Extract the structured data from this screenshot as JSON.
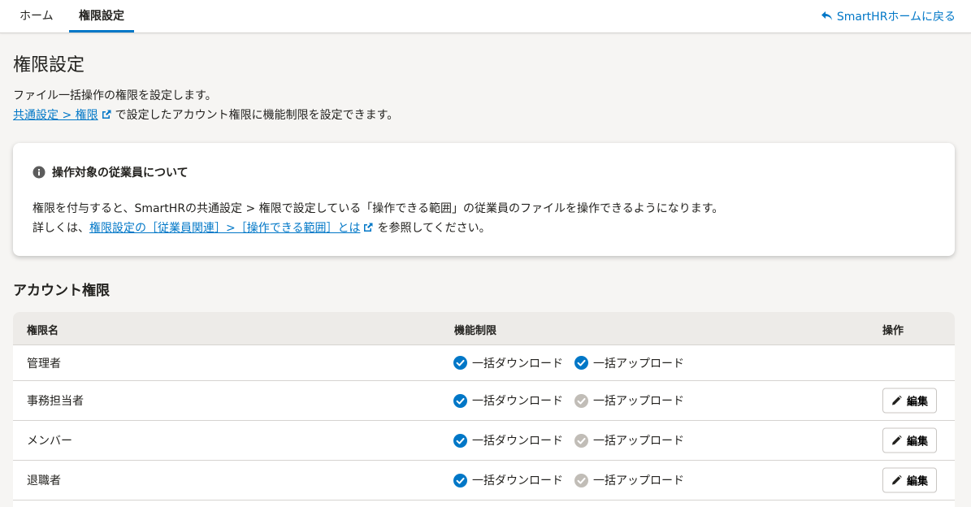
{
  "nav": {
    "tabs": [
      {
        "label": "ホーム",
        "active": false
      },
      {
        "label": "権限設定",
        "active": true
      }
    ],
    "back_link": "SmartHRホームに戻る"
  },
  "page": {
    "title": "権限設定",
    "description": "ファイル一括操作の権限を設定します。",
    "settings_link": "共通設定 > 権限",
    "settings_suffix": "で設定したアカウント権限に機能制限を設定できます。"
  },
  "info": {
    "title": "操作対象の従業員について",
    "line1": "権限を付与すると、SmartHRの共通設定 > 権限で設定している「操作できる範囲」の従業員のファイルを操作できるようになります。",
    "line2_prefix": "詳しくは、",
    "line2_link": "権限設定の［従業員関連］>［操作できる範囲］とは",
    "line2_suffix": "を参照してください。"
  },
  "section": {
    "title": "アカウント権限"
  },
  "table": {
    "headers": {
      "name": "権限名",
      "restrictions": "機能制限",
      "actions": "操作"
    },
    "rows": [
      {
        "name": "管理者",
        "download": "一括ダウンロード",
        "download_enabled": true,
        "upload": "一括アップロード",
        "upload_enabled": true,
        "edit": ""
      },
      {
        "name": "事務担当者",
        "download": "一括ダウンロード",
        "download_enabled": true,
        "upload": "一括アップロード",
        "upload_enabled": false,
        "edit": "編集"
      },
      {
        "name": "メンバー",
        "download": "一括ダウンロード",
        "download_enabled": true,
        "upload": "一括アップロード",
        "upload_enabled": false,
        "edit": "編集"
      },
      {
        "name": "退職者",
        "download": "一括ダウンロード",
        "download_enabled": true,
        "upload": "一括アップロード",
        "upload_enabled": false,
        "edit": "編集"
      }
    ]
  },
  "colors": {
    "accent": "#0077c7",
    "check_enabled": "#0077c7",
    "check_disabled": "#c1bdb7"
  },
  "icons": {
    "back": "undo-arrow-icon",
    "external": "external-link-icon",
    "info": "info-circle-icon",
    "check": "check-circle-icon",
    "edit": "pencil-icon"
  }
}
